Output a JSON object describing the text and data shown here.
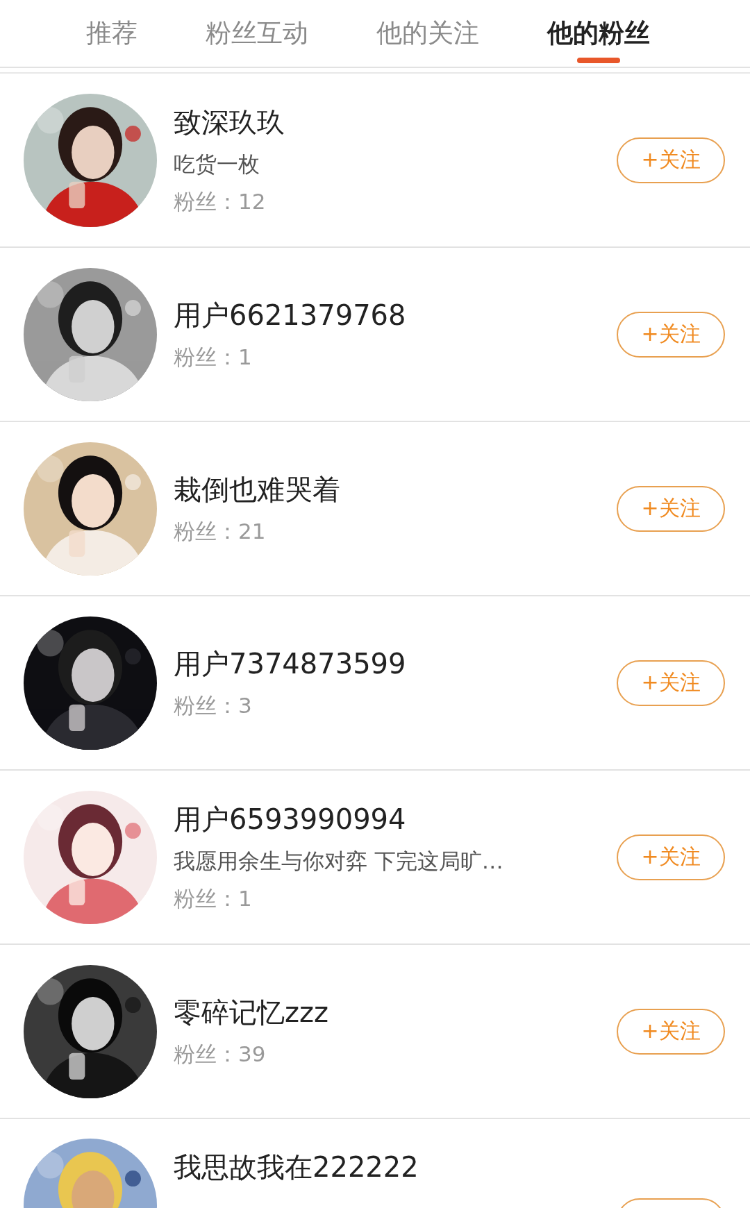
{
  "tabs": [
    {
      "label": "推荐",
      "selected": false
    },
    {
      "label": "粉丝互动",
      "selected": false
    },
    {
      "label": "他的关注",
      "selected": false
    },
    {
      "label": "他的粉丝",
      "selected": true
    }
  ],
  "users": [
    {
      "name": "致深玖玖",
      "bio": "吃货一枚",
      "fans": "粉丝：12",
      "follow_button": "+关注"
    },
    {
      "name": "用户6621379768",
      "fans": "粉丝：1",
      "follow_button": "+关注"
    },
    {
      "name": "栽倒也难哭着",
      "fans": "粉丝：21",
      "follow_button": "+关注"
    },
    {
      "name": "用户7374873599",
      "fans": "粉丝：3",
      "follow_button": "+关注"
    },
    {
      "name": "用户6593990994",
      "bio": "我愿用余生与你对弈 下完这局旷…",
      "fans": "粉丝：1",
      "follow_button": "+关注"
    },
    {
      "name": "零碎记忆zzz",
      "fans": "粉丝：39",
      "follow_button": "+关注"
    },
    {
      "name": "我思故我在222222"
    }
  ]
}
